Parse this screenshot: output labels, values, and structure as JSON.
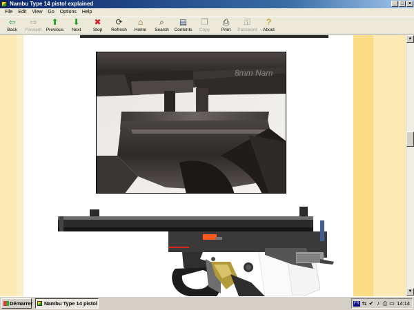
{
  "window": {
    "title": "Nambu Type 14 pistol explained",
    "controls": [
      "_",
      "□",
      "×"
    ]
  },
  "menu": [
    "File",
    "Edit",
    "View",
    "Go",
    "Options",
    "Help"
  ],
  "toolbar": [
    {
      "label": "Back",
      "icon": "back-arrow-icon",
      "glyph": "⇦",
      "color": "#2a8a3a",
      "enabled": true
    },
    {
      "label": "Forward",
      "icon": "forward-arrow-icon",
      "glyph": "⇨",
      "color": "#9a9a9a",
      "enabled": false
    },
    {
      "label": "Previous",
      "icon": "up-arrow-icon",
      "glyph": "⬆",
      "color": "#1e9e2a",
      "enabled": true
    },
    {
      "label": "Next",
      "icon": "down-arrow-icon",
      "glyph": "⬇",
      "color": "#1e9e2a",
      "enabled": true
    },
    {
      "label": "Stop",
      "icon": "stop-icon",
      "glyph": "✖",
      "color": "#d42020",
      "enabled": true
    },
    {
      "label": "Refresh",
      "icon": "refresh-icon",
      "glyph": "⟳",
      "color": "#333333",
      "enabled": true
    },
    {
      "label": "Home",
      "icon": "home-icon",
      "glyph": "⌂",
      "color": "#8a5a20",
      "enabled": true
    },
    {
      "label": "Search",
      "icon": "search-icon",
      "glyph": "⌕",
      "color": "#333333",
      "enabled": true
    },
    {
      "label": "Contents",
      "icon": "contents-icon",
      "glyph": "▤",
      "color": "#445577",
      "enabled": true
    },
    {
      "label": "Copy",
      "icon": "copy-icon",
      "glyph": "❐",
      "color": "#9a9a9a",
      "enabled": false
    },
    {
      "label": "Print",
      "icon": "print-icon",
      "glyph": "⎙",
      "color": "#333333",
      "enabled": true
    },
    {
      "label": "Password",
      "icon": "key-icon",
      "glyph": "⚿",
      "color": "#9a9a9a",
      "enabled": false
    },
    {
      "label": "About",
      "icon": "question-icon",
      "glyph": "?",
      "color": "#b08a00",
      "enabled": true
    }
  ],
  "photo": {
    "engraving": "8mm Nam"
  },
  "taskbar": {
    "start_label": "Démarrer",
    "task_label": "Nambu Type 14 pistol ...",
    "tray_lang": "FR",
    "clock": "14:14"
  },
  "colors": {
    "page_bg": "#FFFFFF",
    "side_band": "#FDE9B4",
    "right_band": "#FBDB85",
    "titlebar": "#0A246A"
  }
}
